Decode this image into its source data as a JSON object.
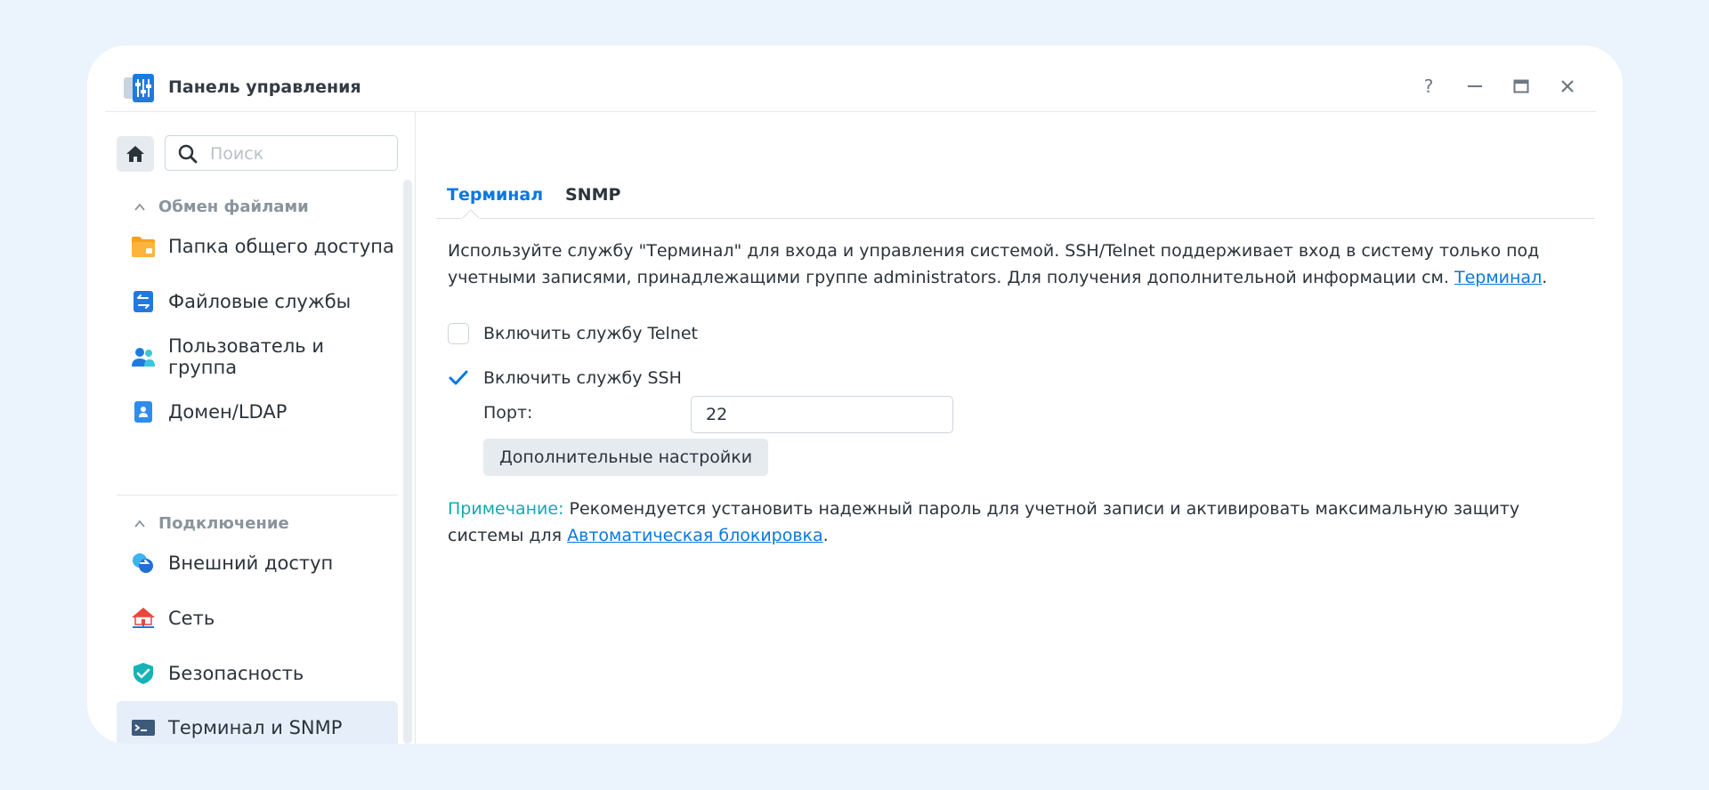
{
  "window": {
    "title": "Панель управления",
    "controls": {
      "help": "?",
      "minimize": "—",
      "maximize": "",
      "close": "✕"
    }
  },
  "sidebar": {
    "search_placeholder": "Поиск",
    "sections": [
      {
        "label": "Обмен файлами"
      },
      {
        "label": "Подключение"
      }
    ],
    "items": [
      {
        "label": "Папка общего доступа",
        "icon": "shared-folder-icon"
      },
      {
        "label": "Файловые службы",
        "icon": "file-services-icon"
      },
      {
        "label": "Пользователь и группа",
        "icon": "user-group-icon"
      },
      {
        "label": "Домен/LDAP",
        "icon": "domain-ldap-icon"
      },
      {
        "label": "Внешний доступ",
        "icon": "external-access-icon"
      },
      {
        "label": "Сеть",
        "icon": "network-icon"
      },
      {
        "label": "Безопасность",
        "icon": "security-icon"
      },
      {
        "label": "Терминал и SNMP",
        "icon": "terminal-icon",
        "active": true
      }
    ]
  },
  "main": {
    "tabs": [
      {
        "label": "Терминал",
        "active": true
      },
      {
        "label": "SNMP",
        "active": false
      }
    ],
    "description": {
      "text": "Используйте службу \"Терминал\" для входа и управления системой. SSH/Telnet поддерживает вход в систему только под учетными записями, принадлежащими группе administrators. Для получения дополнительной информации см. ",
      "link": "Терминал",
      "tail": "."
    },
    "telnet": {
      "label": "Включить службу Telnet",
      "checked": false
    },
    "ssh": {
      "label": "Включить службу SSH",
      "checked": true
    },
    "port": {
      "label": "Порт:",
      "value": "22"
    },
    "advanced_button": "Дополнительные настройки",
    "note": {
      "label": "Примечание:",
      "text": " Рекомендуется установить надежный пароль для учетной записи и активировать максимальную защиту системы для ",
      "link": "Автоматическая блокировка",
      "tail": "."
    }
  },
  "colors": {
    "accent": "#0a78e0",
    "note": "#16a8b2",
    "page_background": "#ebf3fd",
    "active_item_background": "#e6eefa"
  }
}
